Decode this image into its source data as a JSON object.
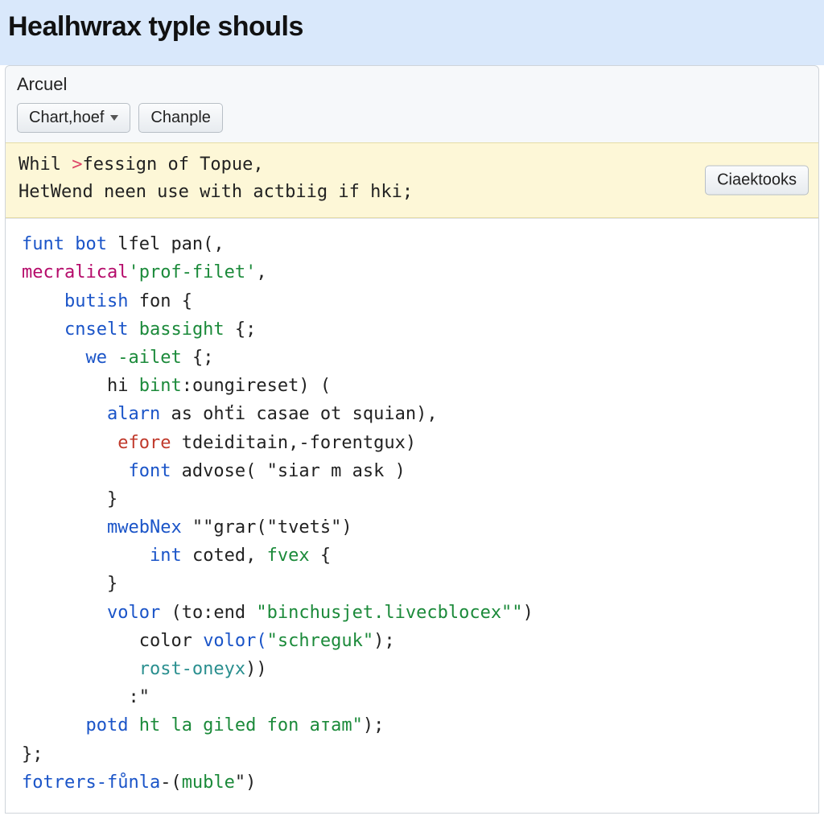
{
  "title": "Healhwrax typle shouls",
  "panel": {
    "title": "Arcuel"
  },
  "toolbar": {
    "chart_label": "Chart,hoef",
    "chanple_label": "Chanple"
  },
  "notice": {
    "line1_a": "Whil ",
    "line1_arrow": ">",
    "line1_b": "fessign of Topue,",
    "line2": "HetWend neen use with actbiig if hki;",
    "button": "Ciaektooks"
  },
  "code": {
    "l1_a": "funt bot",
    "l1_b": " lfel pan(,",
    "l2_a": "mecralical",
    "l2_b": "'prof-filet'",
    "l2_c": ",",
    "l3_a": "butish",
    "l3_b": " fon",
    "l3_c": " {",
    "l4_a": "cnselt",
    "l4_b": " bassight",
    "l4_c": " {;",
    "l5_a": "we",
    "l5_b": " -ailet",
    "l5_c": " {;",
    "l6_a": "hi ",
    "l6_b": "bint",
    "l6_c": ":oungireset) (",
    "l7_a": "alarn",
    "l7_b": " as ohťi casae ot squian),",
    "l8_a": "efore",
    "l8_b": " tdeiditain,-forentgux)",
    "l9_a": "font",
    "l9_b": " advose( \"siar m ask )",
    "l10": "}",
    "l11_a": "mwebNex",
    "l11_b": " \"\"grar(\"tvetṡ\")",
    "l12_a": "int",
    "l12_b": " coted, ",
    "l12_c": "fvex",
    "l12_d": " {",
    "l13": "}",
    "l14_a": "volor",
    "l14_b": " (to:end ",
    "l14_c": "\"binchusjet.livecblocex\"\"",
    "l14_d": ")",
    "l15_a": "color ",
    "l15_b": "volor(",
    "l15_c": "\"schreguk\"",
    "l15_d": ");",
    "l16_a": "rost-oneyx",
    "l16_b": "))",
    "l17": ":\"",
    "l18_a": "potd",
    "l18_b": " ht la giled fon aтam\"",
    "l18_c": ");",
    "l19": "};",
    "l20_a": "fotrers-fůnla",
    "l20_b": "-(",
    "l20_c": "muble",
    "l20_d": "\")"
  }
}
